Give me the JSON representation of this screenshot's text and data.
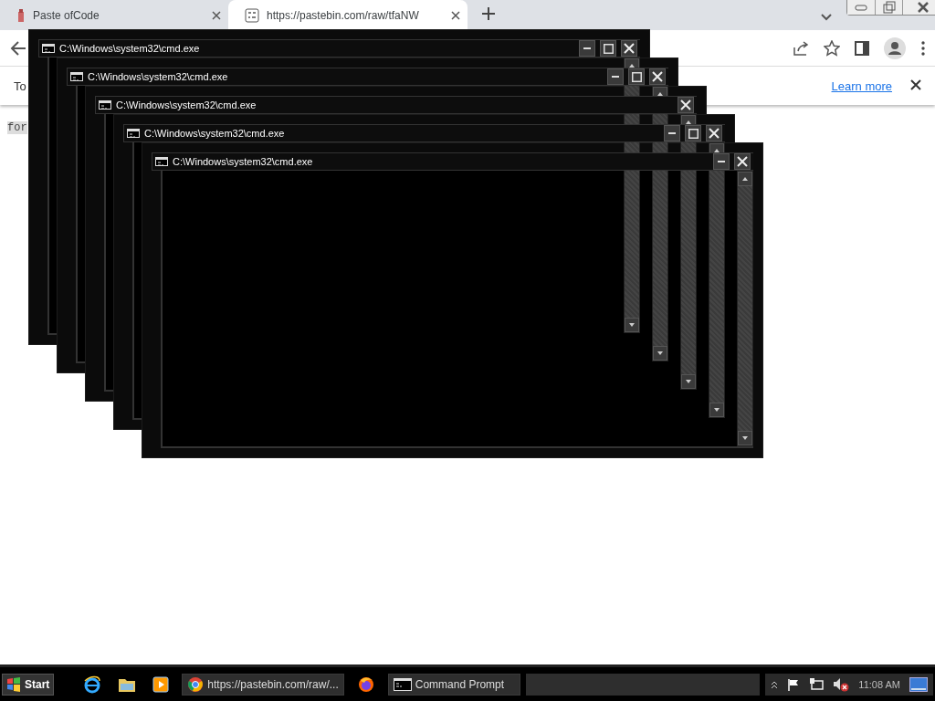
{
  "browser": {
    "tabs": [
      {
        "title": "Paste ofCode",
        "kind": "page",
        "selected": false
      },
      {
        "title": "https://pastebin.com/raw/tfaNW",
        "kind": "binary",
        "selected": true
      }
    ],
    "infobar": {
      "text": "To",
      "link": "Learn more"
    },
    "page_text": "for"
  },
  "cmd_windows": [
    {
      "title": "C:\\Windows\\system32\\cmd.exe",
      "buttons": [
        {
          "kind": "minimize"
        },
        {
          "kind": "maximize"
        },
        {
          "kind": "close"
        }
      ]
    },
    {
      "title": "C:\\Windows\\system32\\cmd.exe",
      "buttons": [
        {
          "kind": "minimize"
        },
        {
          "kind": "maximize"
        },
        {
          "kind": "close"
        }
      ]
    },
    {
      "title": "C:\\Windows\\system32\\cmd.exe",
      "buttons": [
        {
          "kind": "close"
        }
      ]
    },
    {
      "title": "C:\\Windows\\system32\\cmd.exe",
      "buttons": [
        {
          "kind": "minimize"
        },
        {
          "kind": "maximize"
        },
        {
          "kind": "close"
        }
      ]
    },
    {
      "title": "C:\\Windows\\system32\\cmd.exe",
      "buttons": [
        {
          "kind": "minimize"
        },
        {
          "kind": "close"
        }
      ]
    }
  ],
  "taskbar": {
    "start": "Start",
    "items": [
      {
        "kind": "globe"
      },
      {
        "kind": "folder"
      },
      {
        "kind": "player"
      },
      {
        "kind": "chrome",
        "label": "https://pastebin.com/raw/..."
      },
      {
        "kind": "firefox"
      },
      {
        "kind": "console",
        "label": "Command Prompt"
      }
    ],
    "clock": "11:08 AM"
  }
}
